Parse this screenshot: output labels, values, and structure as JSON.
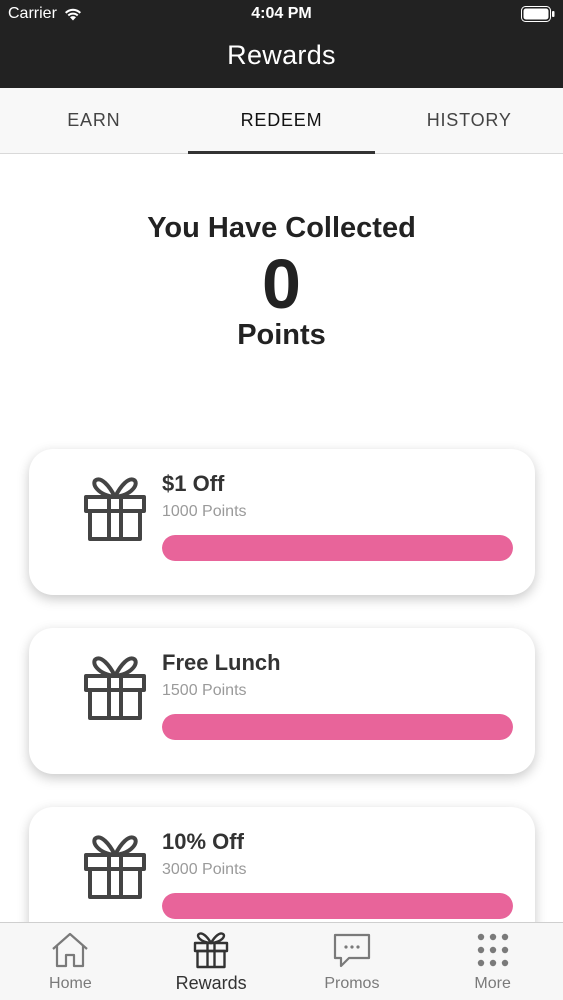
{
  "status_bar": {
    "carrier": "Carrier",
    "time": "4:04 PM"
  },
  "nav": {
    "title": "Rewards"
  },
  "tabs": [
    {
      "label": "EARN",
      "active": false
    },
    {
      "label": "REDEEM",
      "active": true
    },
    {
      "label": "HISTORY",
      "active": false
    }
  ],
  "summary": {
    "title": "You Have Collected",
    "value": "0",
    "unit": "Points"
  },
  "rewards": [
    {
      "name": "$1 Off",
      "points": "1000 Points",
      "icon": "gift-icon",
      "progress": 0
    },
    {
      "name": "Free Lunch",
      "points": "1500 Points",
      "icon": "gift-icon",
      "progress": 0
    },
    {
      "name": "10% Off",
      "points": "3000 Points",
      "icon": "gift-icon",
      "progress": 0
    }
  ],
  "tabbar": [
    {
      "label": "Home",
      "icon": "home-icon",
      "active": false
    },
    {
      "label": "Rewards",
      "icon": "gift-icon",
      "active": true
    },
    {
      "label": "Promos",
      "icon": "chat-bubble-icon",
      "active": false
    },
    {
      "label": "More",
      "icon": "grid-dots-icon",
      "active": false
    }
  ],
  "colors": {
    "header_bg": "#222222",
    "progress": "#e8649a",
    "accent_text": "#333333"
  }
}
